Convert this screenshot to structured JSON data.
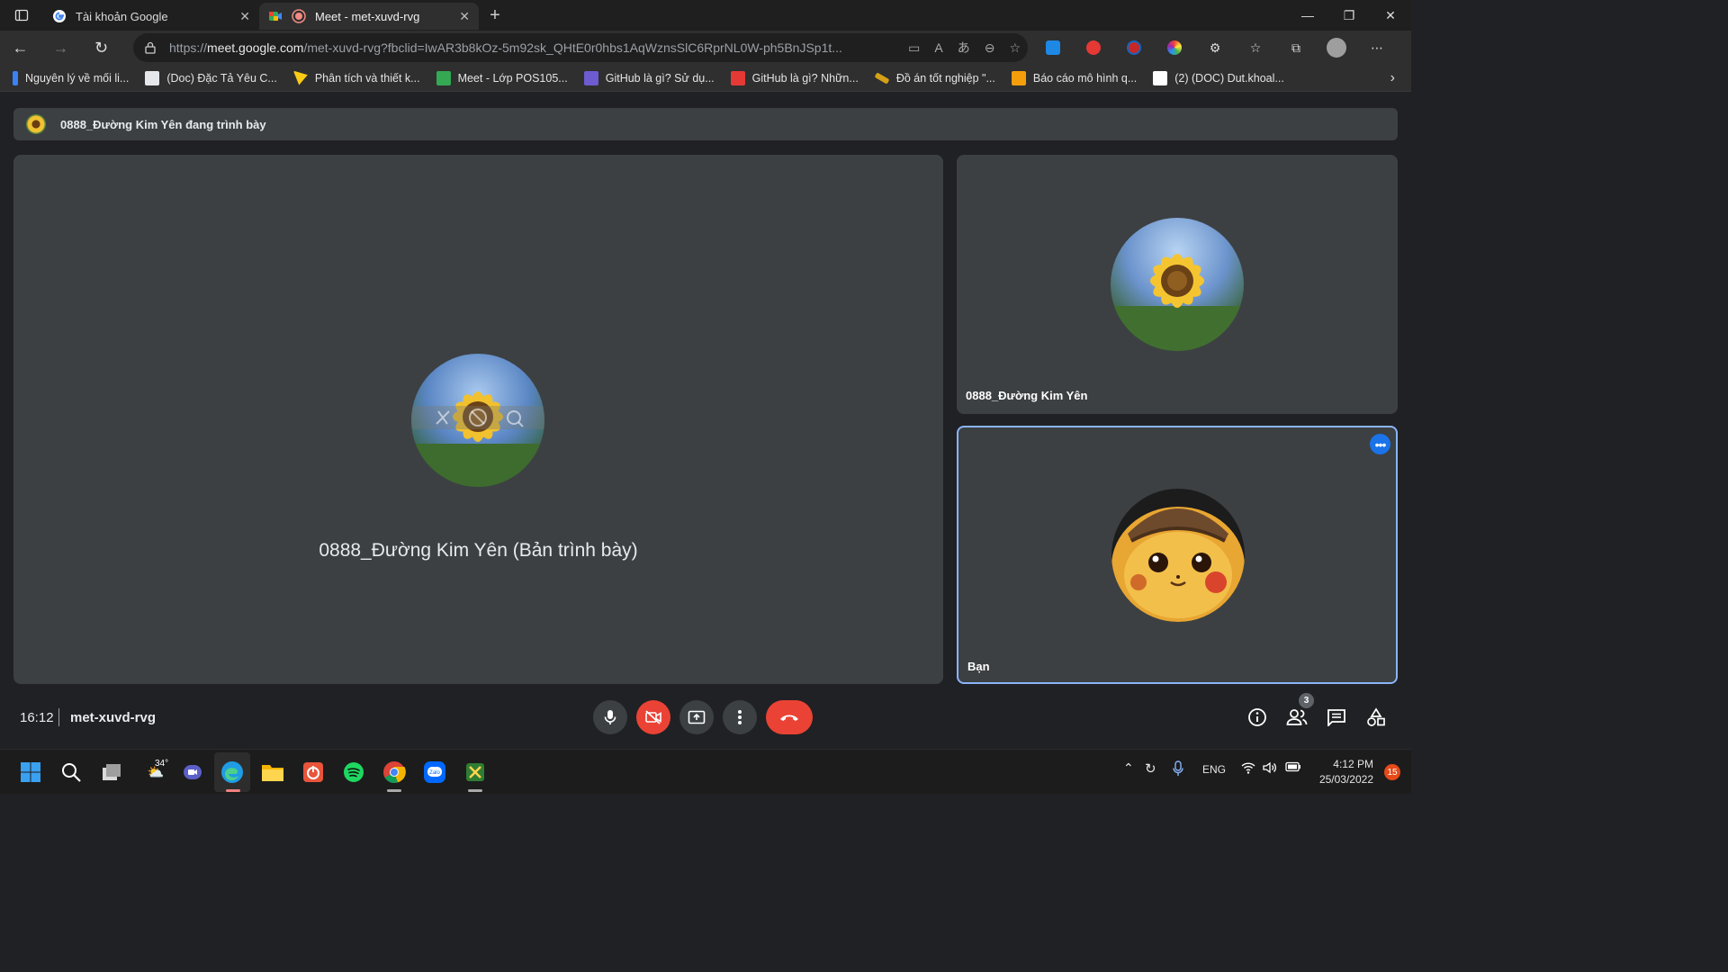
{
  "browser": {
    "tabs": [
      {
        "title": "Tài khoản Google",
        "icon": "google-icon"
      },
      {
        "title": "Meet - met-xuvd-rvg",
        "icon": "meet-icon",
        "active": true
      }
    ],
    "new_tab": "+",
    "address": {
      "url_prefix": "https://",
      "url_host": "meet.google.com",
      "url_rest": "/met-xuvd-rvg?fbclid=IwAR3b8kOz-5m92sk_QHtE0r0hbs1AqWznsSlC6RprNL0W-ph5BnJSp1t..."
    },
    "bookmarks": [
      {
        "label": "Nguyên lý về mối li...",
        "color": "#3b82f6"
      },
      {
        "label": "(Doc) Đặc Tả Yêu C...",
        "color": "#e5e7eb"
      },
      {
        "label": "Phân tích và thiết k...",
        "color": "#facc15"
      },
      {
        "label": "Meet - Lớp POS105...",
        "color": "#34a853"
      },
      {
        "label": "GitHub là gì? Sử dụ...",
        "color": "#6d5bd0"
      },
      {
        "label": "GitHub là gì? Nhữn...",
        "color": "#e53935"
      },
      {
        "label": "Đồ án tốt nghiệp \"...",
        "color": "#d4a017"
      },
      {
        "label": "Báo cáo mô hình q...",
        "color": "#f59e0b"
      },
      {
        "label": "(2) (DOC) Dut.khoal...",
        "color": "#ffffff"
      }
    ]
  },
  "meet": {
    "presenting_text": "0888_Đường Kim Yên đang trình bày",
    "main_tile_name": "0888_Đường Kim Yên (Bản trình bày)",
    "participants": [
      {
        "name": "0888_Đường Kim Yên",
        "avatar": "sunflower-avatar"
      },
      {
        "name": "Bạn",
        "avatar": "pikachu-avatar"
      }
    ],
    "time": "16:12",
    "meeting_code": "met-xuvd-rvg",
    "people_count": "3",
    "accent": "#8ab4f8",
    "danger": "#ea4335"
  },
  "taskbar": {
    "weather": "34°",
    "language": "ENG",
    "clock_time": "4:12 PM",
    "clock_date": "25/03/2022",
    "notifications": "15"
  }
}
